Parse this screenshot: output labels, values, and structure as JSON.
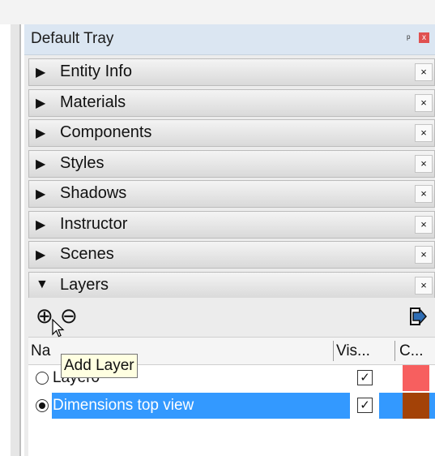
{
  "tray": {
    "title": "Default Tray",
    "pin_glyph": "ᵖ",
    "close_glyph": "x"
  },
  "panels": [
    {
      "label": "Entity Info",
      "expanded": false
    },
    {
      "label": "Materials",
      "expanded": false
    },
    {
      "label": "Components",
      "expanded": false
    },
    {
      "label": "Styles",
      "expanded": false
    },
    {
      "label": "Shadows",
      "expanded": false
    },
    {
      "label": "Instructor",
      "expanded": false
    },
    {
      "label": "Scenes",
      "expanded": false
    },
    {
      "label": "Layers",
      "expanded": true
    }
  ],
  "glyphs": {
    "collapsed_arrow": "▶",
    "expanded_arrow": "▼",
    "panel_close": "×",
    "add": "⊕",
    "remove": "⊖",
    "check": "✓"
  },
  "layers": {
    "columns": {
      "name": "Na",
      "visible": "Vis...",
      "color": "C..."
    },
    "rows": [
      {
        "name": "Layer0",
        "active": false,
        "visible": true,
        "color": "#f75f5f"
      },
      {
        "name": "Dimensions top view",
        "active": true,
        "visible": true,
        "color": "#a34207"
      }
    ],
    "tooltip": "Add Layer"
  },
  "icons": {
    "add_layer": "add-layer-icon",
    "remove_layer": "remove-layer-icon",
    "details": "details-arrow-icon"
  },
  "colors": {
    "selection": "#3399ff",
    "tray_header": "#dbe6f2"
  }
}
